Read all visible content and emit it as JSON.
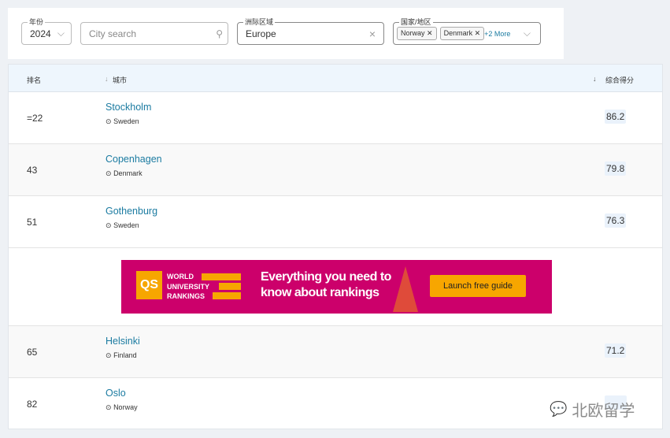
{
  "filters": {
    "year": {
      "label": "年份",
      "value": "2024"
    },
    "city_search": {
      "placeholder": "City search"
    },
    "region": {
      "label": "洲际区域",
      "value": "Europe"
    },
    "country": {
      "label": "国家/地区",
      "chips": [
        "Norway",
        "Denmark"
      ],
      "more": "+2 More"
    }
  },
  "table": {
    "headers": {
      "rank": "排名",
      "city": "城市",
      "score": "综合得分"
    },
    "rows": [
      {
        "rank": "=22",
        "city": "Stockholm",
        "country": "Sweden",
        "score": "86.2"
      },
      {
        "rank": "43",
        "city": "Copenhagen",
        "country": "Denmark",
        "score": "79.8"
      },
      {
        "rank": "51",
        "city": "Gothenburg",
        "country": "Sweden",
        "score": "76.3"
      },
      {
        "rank": "65",
        "city": "Helsinki",
        "country": "Finland",
        "score": "71.2"
      },
      {
        "rank": "82",
        "city": "Oslo",
        "country": "Norway",
        "score": ""
      }
    ]
  },
  "ad": {
    "logo": "QS",
    "logo_lines": [
      "WORLD",
      "UNIVERSITY",
      "RANKINGS"
    ],
    "headline1": "Everything you need to",
    "headline2": "know about rankings",
    "cta": "Launch free guide",
    "bg": "#cc006b",
    "accent": "#f7a600"
  },
  "watermark": {
    "text": "北欧留学",
    "icon": "wechat-icon"
  }
}
